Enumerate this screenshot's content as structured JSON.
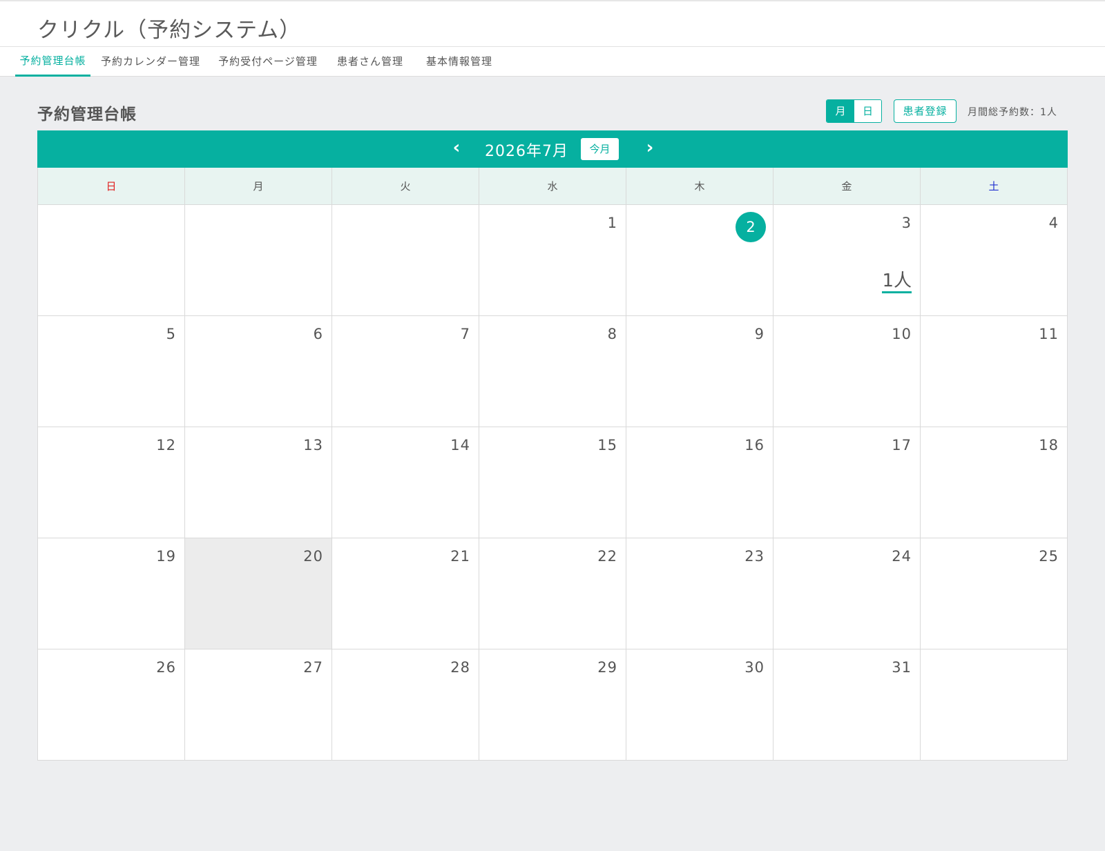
{
  "app": {
    "title": "クリクル（予約システム）"
  },
  "nav": {
    "items": [
      {
        "label": "予約管理台帳"
      },
      {
        "label": "予約カレンダー管理"
      },
      {
        "label": "予約受付ページ管理"
      },
      {
        "label": "患者さん管理"
      },
      {
        "label": "基本情報管理"
      }
    ]
  },
  "page": {
    "title": "予約管理台帳",
    "view_month": "月",
    "view_day": "日",
    "register_button": "患者登録",
    "total_label": "月間総予約数：1人"
  },
  "calendar": {
    "prev": "‹",
    "next": "›",
    "month_label": "2026年7月",
    "today_button": "今月",
    "weekdays": [
      "日",
      "月",
      "火",
      "水",
      "木",
      "金",
      "土"
    ],
    "weeks": [
      [
        {
          "day": ""
        },
        {
          "day": ""
        },
        {
          "day": ""
        },
        {
          "day": "1"
        },
        {
          "day": "2",
          "today": true
        },
        {
          "day": "3",
          "count": "1人"
        },
        {
          "day": "4"
        }
      ],
      [
        {
          "day": "5"
        },
        {
          "day": "6"
        },
        {
          "day": "7"
        },
        {
          "day": "8"
        },
        {
          "day": "9"
        },
        {
          "day": "10"
        },
        {
          "day": "11"
        }
      ],
      [
        {
          "day": "12"
        },
        {
          "day": "13"
        },
        {
          "day": "14"
        },
        {
          "day": "15"
        },
        {
          "day": "16"
        },
        {
          "day": "17"
        },
        {
          "day": "18"
        }
      ],
      [
        {
          "day": "19"
        },
        {
          "day": "20",
          "shaded": true
        },
        {
          "day": "21"
        },
        {
          "day": "22"
        },
        {
          "day": "23"
        },
        {
          "day": "24"
        },
        {
          "day": "25"
        }
      ],
      [
        {
          "day": "26"
        },
        {
          "day": "27"
        },
        {
          "day": "28"
        },
        {
          "day": "29"
        },
        {
          "day": "30"
        },
        {
          "day": "31"
        },
        {
          "day": ""
        }
      ]
    ]
  },
  "colors": {
    "accent": "#06b0a0",
    "sunday": "#e02020",
    "saturday": "#2030d0"
  }
}
